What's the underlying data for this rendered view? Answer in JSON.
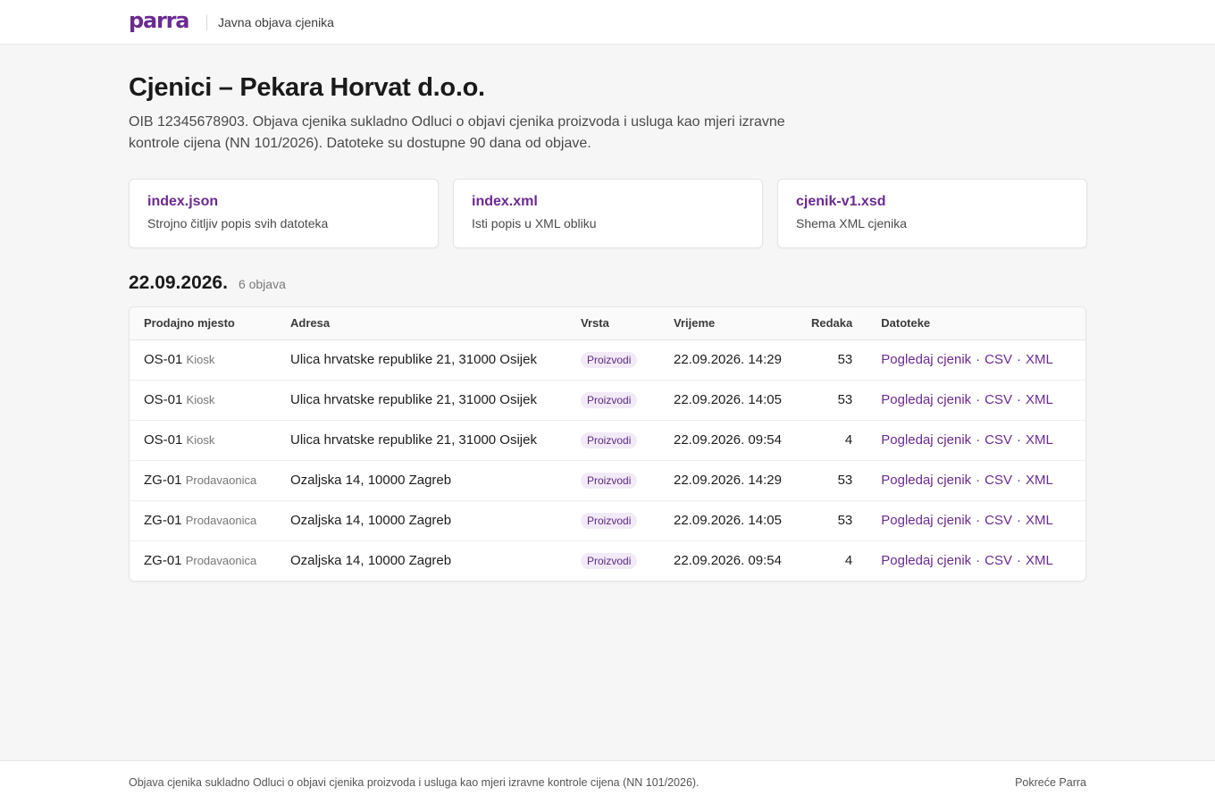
{
  "header": {
    "logo_text": "parra",
    "subtitle": "Javna objava cjenika"
  },
  "page": {
    "title": "Cjenici – Pekara Horvat d.o.o.",
    "intro": "OIB 12345678903. Objava cjenika sukladno Odluci o objavi cjenika proizvoda i usluga kao mjeri izravne kontrole cijena (NN 101/2026). Datoteke su dostupne 90 dana od objave."
  },
  "cards": [
    {
      "title": "index.json",
      "desc": "Strojno čitljiv popis svih datoteka"
    },
    {
      "title": "index.xml",
      "desc": "Isti popis u XML obliku"
    },
    {
      "title": "cjenik-v1.xsd",
      "desc": "Shema XML cjenika"
    }
  ],
  "section": {
    "date": "22.09.2026.",
    "count": "6 objava"
  },
  "table": {
    "headers": {
      "location": "Prodajno mjesto",
      "address": "Adresa",
      "type": "Vrsta",
      "time": "Vrijeme",
      "rows": "Redaka",
      "files": "Datoteke"
    },
    "links": {
      "view": "Pogledaj cjenik",
      "csv": "CSV",
      "xml": "XML",
      "separator": "·"
    },
    "rows": [
      {
        "code": "OS-01",
        "loc_type": "Kiosk",
        "address": "Ulica hrvatske republike 21, 31000 Osijek",
        "type": "Proizvodi",
        "time": "22.09.2026. 14:29",
        "count": "53"
      },
      {
        "code": "OS-01",
        "loc_type": "Kiosk",
        "address": "Ulica hrvatske republike 21, 31000 Osijek",
        "type": "Proizvodi",
        "time": "22.09.2026. 14:05",
        "count": "53"
      },
      {
        "code": "OS-01",
        "loc_type": "Kiosk",
        "address": "Ulica hrvatske republike 21, 31000 Osijek",
        "type": "Proizvodi",
        "time": "22.09.2026. 09:54",
        "count": "4"
      },
      {
        "code": "ZG-01",
        "loc_type": "Prodavaonica",
        "address": "Ozaljska 14, 10000 Zagreb",
        "type": "Proizvodi",
        "time": "22.09.2026. 14:29",
        "count": "53"
      },
      {
        "code": "ZG-01",
        "loc_type": "Prodavaonica",
        "address": "Ozaljska 14, 10000 Zagreb",
        "type": "Proizvodi",
        "time": "22.09.2026. 14:05",
        "count": "53"
      },
      {
        "code": "ZG-01",
        "loc_type": "Prodavaonica",
        "address": "Ozaljska 14, 10000 Zagreb",
        "type": "Proizvodi",
        "time": "22.09.2026. 09:54",
        "count": "4"
      }
    ]
  },
  "footer": {
    "left": "Objava cjenika sukladno Odluci o objavi cjenika proizvoda i usluga kao mjeri izravne kontrole cijena (NN 101/2026).",
    "right": "Pokreće Parra"
  },
  "colors": {
    "brand": "#6b2a91",
    "background": "#f6f6f6",
    "badge_bg": "#f2eaf7"
  }
}
